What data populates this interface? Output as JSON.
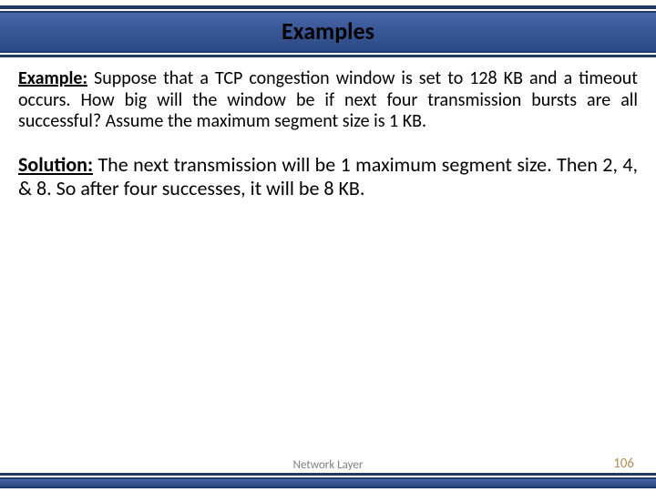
{
  "header": {
    "title": "Examples"
  },
  "body": {
    "example_label": "Example:",
    "example_text": " Suppose that a TCP congestion window is set to 128 KB and a timeout occurs. How big will the window be if next four transmission bursts are all successful? Assume the maximum segment size is 1 KB.",
    "solution_label": "Solution:",
    "solution_text": " The next transmission will be 1 maximum segment size. Then 2, 4, & 8. So after four successes, it will be 8 KB."
  },
  "footer": {
    "label": "Network Layer",
    "page_number": "106"
  }
}
